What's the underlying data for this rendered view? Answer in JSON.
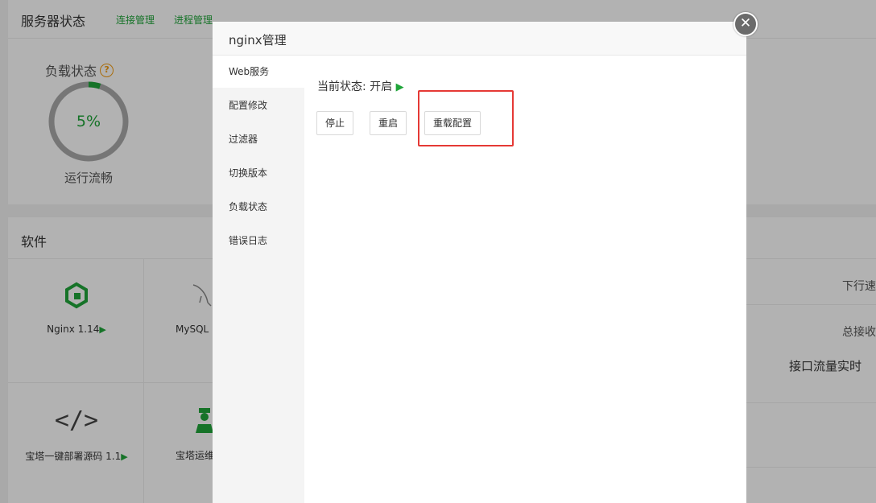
{
  "server": {
    "title": "服务器状态",
    "links": [
      "连接管理",
      "进程管理"
    ],
    "load_label": "负载状态",
    "help_icon": "question-circle-icon",
    "load_percent": 5,
    "load_value": "5%",
    "load_status": "运行流畅"
  },
  "software": {
    "title": "软件",
    "items": [
      {
        "icon": "nginx-g-icon",
        "label": "Nginx 1.14",
        "arrow": "▶"
      },
      {
        "icon": "mysql-dolphin-icon",
        "label": "MySQL",
        "arrow": ""
      },
      {
        "icon": "code-icon",
        "label": "宝塔一键部署源码 1.1",
        "arrow": "▶"
      },
      {
        "icon": "ops-person-icon",
        "label": "宝塔运维",
        "arrow": ""
      }
    ],
    "right": {
      "down_speed": "下行速",
      "total_recv": "总接收",
      "realtime": "接口流量实时"
    }
  },
  "modal": {
    "title": "nginx管理",
    "close_icon": "close-icon",
    "menu": [
      "Web服务",
      "配置修改",
      "过滤器",
      "切换版本",
      "负载状态",
      "错误日志"
    ],
    "active_index": 0,
    "status_label": "当前状态:",
    "status_value": "开启",
    "status_icon": "▶",
    "buttons": {
      "stop": "停止",
      "restart": "重启",
      "reload": "重载配置"
    }
  },
  "colors": {
    "accent": "#20a53a",
    "highlight": "#e53935",
    "help": "#f39c12"
  }
}
